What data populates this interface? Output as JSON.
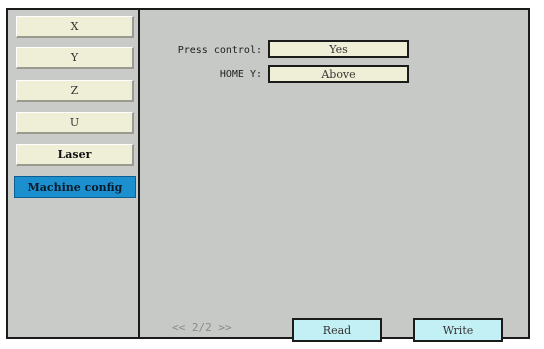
{
  "sidebar": {
    "items": [
      {
        "label": "X"
      },
      {
        "label": "Y"
      },
      {
        "label": "Z"
      },
      {
        "label": "U"
      },
      {
        "label": "Laser"
      },
      {
        "label": "Machine config"
      }
    ]
  },
  "settings": {
    "press_control": {
      "label": "Press control:",
      "value": "Yes"
    },
    "home_y": {
      "label": "HOME Y:",
      "value": "Above"
    }
  },
  "footer": {
    "page_indicator": "<< 2/2 >>",
    "read_label": "Read",
    "write_label": "Write"
  },
  "colors": {
    "panel": "#c7c9c6",
    "button": "#efeed6",
    "active": "#1c8fcf",
    "action": "#c3f0f4"
  }
}
